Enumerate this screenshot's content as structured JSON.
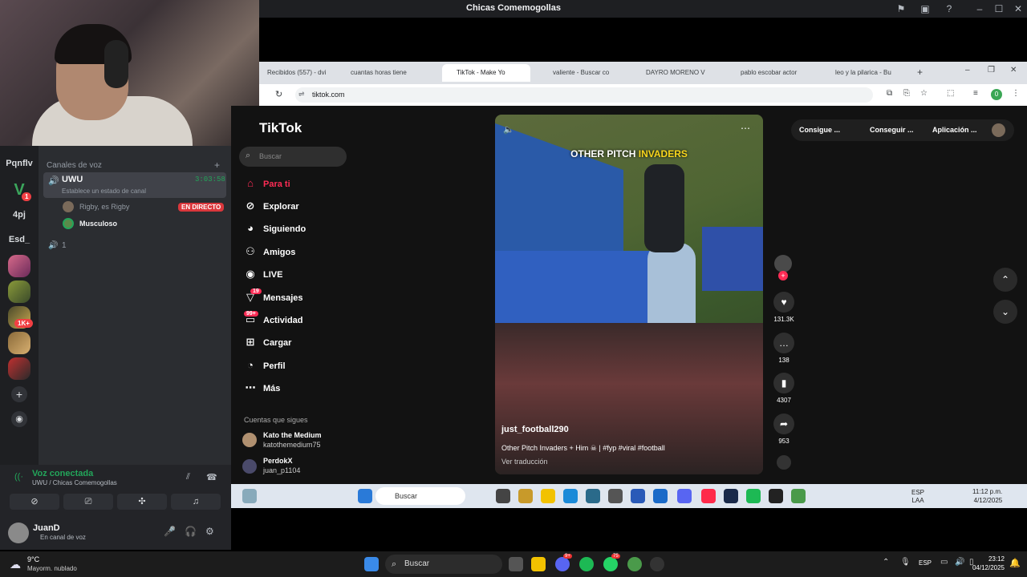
{
  "window": {
    "title": "Chicas Comemogollas"
  },
  "discord": {
    "guilds": [
      {
        "label": "Pqnflv"
      },
      {
        "label": "4pj"
      },
      {
        "label": "Esd_"
      }
    ],
    "guild_badges": [
      "1",
      "1K+"
    ],
    "voice_section": "Canales de voz",
    "channel": {
      "name": "UWU",
      "timer": "3:03:58",
      "status_hint": "Establece un estado de canal",
      "members": [
        {
          "name": "Rigby, es Rigby",
          "badge": "EN DIRECTO"
        },
        {
          "name": "Musculoso"
        }
      ]
    },
    "second_channel": "1",
    "voice_panel": {
      "status": "Voz conectada",
      "location": "UWU / Chicas Comemogollas"
    },
    "user": {
      "name": "JuanD",
      "status": "En canal de voz"
    }
  },
  "browser": {
    "tabs": [
      {
        "label": "Recibidos (557) - dvi"
      },
      {
        "label": "cuantas horas tiene"
      },
      {
        "label": "TikTok - Make Yo"
      },
      {
        "label": "valiente - Buscar co"
      },
      {
        "label": "DAYRO MORENO V"
      },
      {
        "label": "pablo escobar actor"
      },
      {
        "label": "leo y la pilarica - Bu"
      }
    ],
    "url": "tiktok.com",
    "profile_initial": "0"
  },
  "tiktok": {
    "logo": "TikTok",
    "search_placeholder": "Buscar",
    "nav": [
      {
        "label": "Para ti",
        "icon": "home-icon"
      },
      {
        "label": "Explorar",
        "icon": "compass-icon"
      },
      {
        "label": "Siguiendo",
        "icon": "avatar-icon"
      },
      {
        "label": "Amigos",
        "icon": "friends-icon"
      },
      {
        "label": "LIVE",
        "icon": "live-icon"
      },
      {
        "label": "Mensajes",
        "icon": "message-icon",
        "badge": "19"
      },
      {
        "label": "Actividad",
        "icon": "activity-icon",
        "badge": "99+"
      },
      {
        "label": "Cargar",
        "icon": "upload-icon"
      },
      {
        "label": "Perfil",
        "icon": "profile-icon"
      },
      {
        "label": "Más",
        "icon": "more-icon"
      }
    ],
    "following_title": "Cuentas que sigues",
    "following": [
      {
        "name": "Kato the Medium",
        "handle": "katothemedium75"
      },
      {
        "name": "PerdokX",
        "handle": "juan_p1104"
      }
    ],
    "top_buttons": [
      "Consigue ...",
      "Conseguir ...",
      "Aplicación ..."
    ],
    "video": {
      "overlay_text_1": "OTHER PITCH ",
      "overlay_text_2": "INVADERS",
      "author": "just_football290",
      "caption": "Other Pitch Invaders + Him ☠ | #fyp #viral #football",
      "translate": "Ver traducción"
    },
    "actions": {
      "likes": "131.3K",
      "comments": "138",
      "saves": "4307",
      "shares": "953"
    },
    "accent": "#fe2c55"
  },
  "inner_taskbar": {
    "search": "Buscar",
    "lang": "ESP",
    "lang2": "LAA",
    "time": "11:12 p.m.",
    "date": "4/12/2025"
  },
  "taskbar": {
    "weather_temp": "9°C",
    "weather_desc": "Mayorm. nublado",
    "search": "Buscar",
    "lang": "ESP",
    "time": "23:12",
    "date": "04/12/2025",
    "badges": [
      "9+",
      "75"
    ]
  }
}
